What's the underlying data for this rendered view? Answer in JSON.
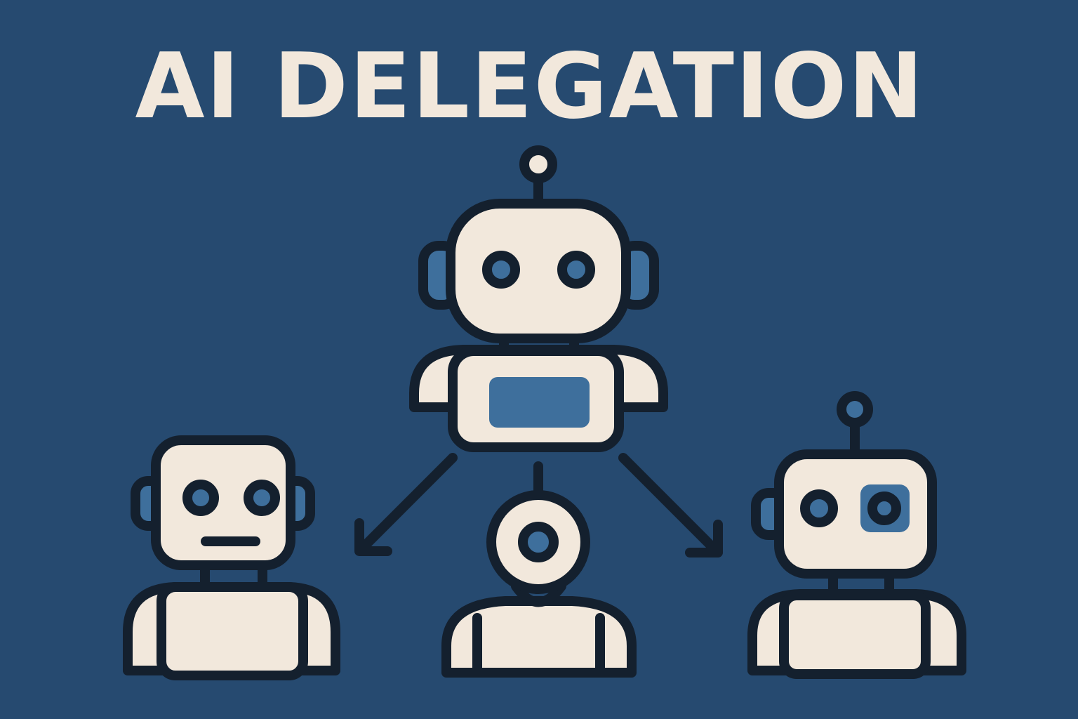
{
  "title": "AI DELEGATION",
  "colors": {
    "background": "#264a70",
    "cream": "#f2e8dc",
    "outline": "#14202e",
    "accent_blue": "#3e6f9c"
  },
  "figures": [
    {
      "role": "delegator",
      "icon": "robot-icon"
    },
    {
      "role": "delegate",
      "icon": "robot-icon"
    },
    {
      "role": "delegate",
      "icon": "robot-camera-icon"
    },
    {
      "role": "delegate",
      "icon": "robot-icon"
    }
  ],
  "arrows": [
    "arrow-down-left-icon",
    "arrow-down-right-icon"
  ]
}
